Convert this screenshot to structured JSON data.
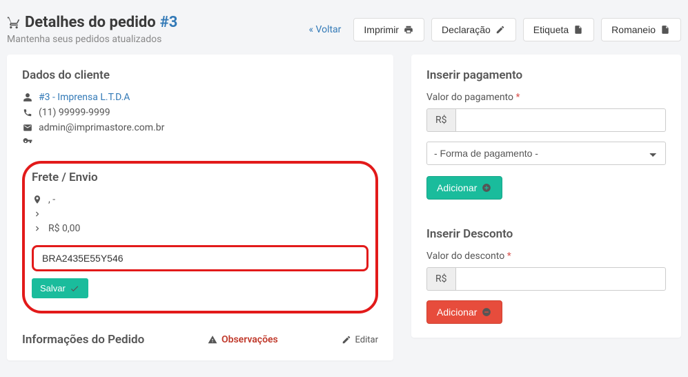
{
  "header": {
    "title_prefix": "Detalhes do pedido",
    "order_number": "#3",
    "subtitle": "Mantenha seus pedidos atualizados",
    "back_label": "« Voltar",
    "actions": {
      "print": "Imprimir",
      "declaration": "Declaração",
      "label": "Etiqueta",
      "packing": "Romaneio"
    }
  },
  "customer": {
    "heading": "Dados do cliente",
    "link_text": "#3 - Imprensa L.T.D.A",
    "phone": "(11) 99999-9999",
    "email": "admin@imprimastore.com.br"
  },
  "shipping": {
    "heading": "Frete / Envio",
    "address": ", -",
    "method": "",
    "cost": "R$ 0,00",
    "tracking_value": "BRA2435E55Y546",
    "save_label": "Salvar"
  },
  "order_info": {
    "heading": "Informações do Pedido",
    "observations_label": "Observações",
    "edit_label": "Editar"
  },
  "payment": {
    "heading": "Inserir pagamento",
    "value_label": "Valor do pagamento",
    "currency": "R$",
    "method_placeholder": "- Forma de pagamento -",
    "add_label": "Adicionar"
  },
  "discount": {
    "heading": "Inserir Desconto",
    "value_label": "Valor do desconto",
    "currency": "R$",
    "add_label": "Adicionar"
  }
}
